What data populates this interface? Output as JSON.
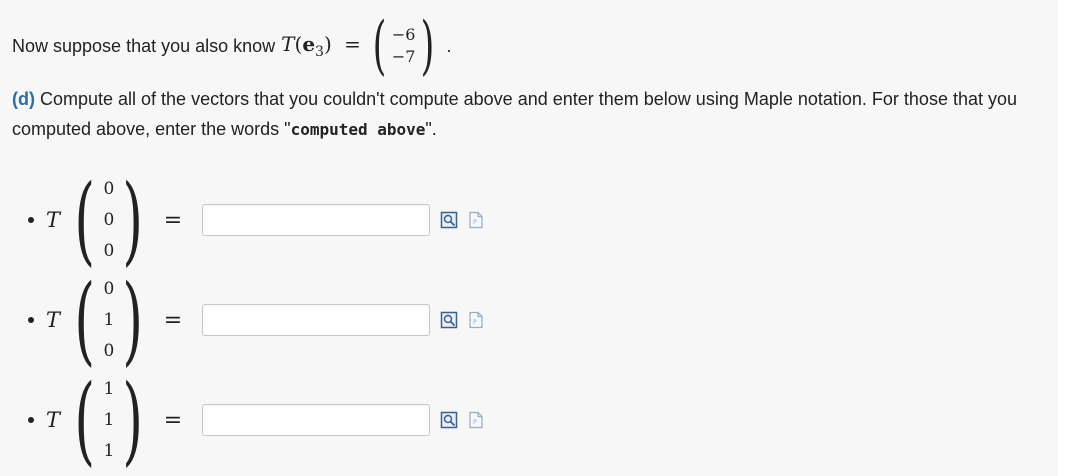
{
  "intro": {
    "prefix": "Now suppose that you also know",
    "func": "T",
    "open": "(",
    "vec": "e",
    "vec_sub": "3",
    "close": ")",
    "equals": "=",
    "values": [
      "−6",
      "−7"
    ],
    "period": "."
  },
  "question": {
    "part_label": "(d)",
    "text1": " Compute all of the vectors that you couldn't compute above and enter them below using Maple notation.  For those that you computed above, enter the words \"",
    "code": "computed above",
    "text2": "\"."
  },
  "rows": [
    {
      "func": "T",
      "vector": [
        "0",
        "0",
        "0"
      ],
      "equals": "=",
      "answer": ""
    },
    {
      "func": "T",
      "vector": [
        "0",
        "1",
        "0"
      ],
      "equals": "=",
      "answer": ""
    },
    {
      "func": "T",
      "vector": [
        "1",
        "1",
        "1"
      ],
      "equals": "=",
      "answer": ""
    }
  ],
  "icons": {
    "preview": "preview-icon",
    "help": "maple-help-icon"
  }
}
